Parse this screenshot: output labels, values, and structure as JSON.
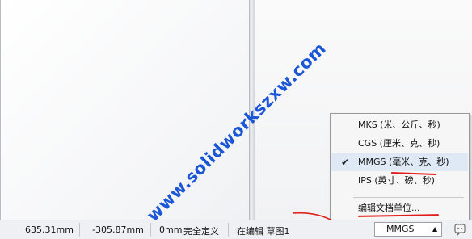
{
  "watermark": {
    "text": "www.solidworkszxw.com"
  },
  "units_menu": {
    "items": [
      {
        "label": "MKS (米、公斤、秒)",
        "checked": false
      },
      {
        "label": "CGS (厘米、克、秒)",
        "checked": false
      },
      {
        "label": "MMGS (毫米、克、秒)",
        "checked": true
      },
      {
        "label": "IPS (英寸、磅、秒)",
        "checked": false
      }
    ],
    "edit_label": "编辑文档单位...",
    "check_mark": "✔"
  },
  "status_bar": {
    "x_coord": "635.31mm",
    "y_coord": "-305.87mm",
    "z_coord": "0mm",
    "definition_state": "完全定义",
    "edit_state": "在编辑 草图1",
    "units_button": "MMGS",
    "units_caret": "▲"
  },
  "colors": {
    "watermark": "#1a56d6",
    "annotation_red": "#e0201c",
    "checked_row": "#dfe9f6"
  }
}
